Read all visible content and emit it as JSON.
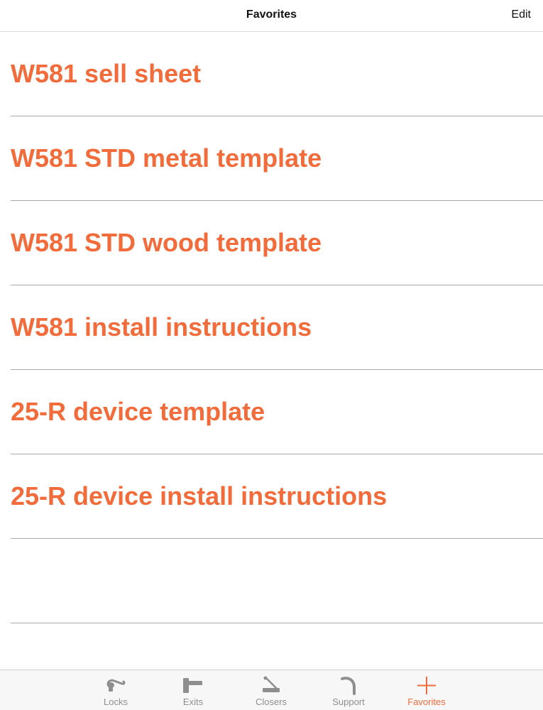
{
  "navbar": {
    "title": "Favorites",
    "edit_label": "Edit"
  },
  "favorites": {
    "items": [
      {
        "label": "W581 sell sheet"
      },
      {
        "label": "W581 STD metal template"
      },
      {
        "label": "W581 STD wood template"
      },
      {
        "label": "W581 install instructions"
      },
      {
        "label": "25-R device template"
      },
      {
        "label": "25-R device install instructions"
      }
    ]
  },
  "tabbar": {
    "tabs": [
      {
        "label": "Locks",
        "icon": "lock-handle-icon"
      },
      {
        "label": "Exits",
        "icon": "exit-device-icon"
      },
      {
        "label": "Closers",
        "icon": "door-closer-icon"
      },
      {
        "label": "Support",
        "icon": "support-hook-icon"
      },
      {
        "label": "Favorites",
        "icon": "plus-icon",
        "active": true
      }
    ]
  },
  "colors": {
    "accent": "#f26b3a",
    "inactive": "#8e8e8e",
    "divider": "#a9a9a9"
  }
}
